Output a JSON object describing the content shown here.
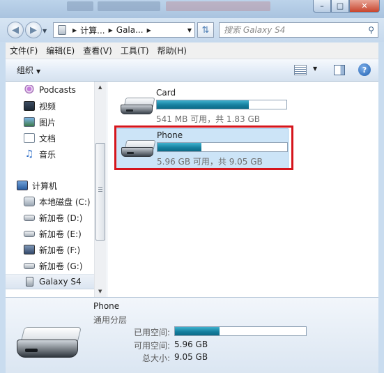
{
  "window": {
    "min_icon": "–",
    "max_icon": "□",
    "close_icon": "✕"
  },
  "address": {
    "crumbs": [
      "计算...",
      "Gala..."
    ],
    "search_placeholder": "搜索 Galaxy S4"
  },
  "menu": [
    "文件(F)",
    "编辑(E)",
    "查看(V)",
    "工具(T)",
    "帮助(H)"
  ],
  "toolbar": {
    "organize": "组织",
    "help": "?"
  },
  "nav": {
    "items": [
      {
        "label": "Podcasts",
        "icon": "podcast-icon"
      },
      {
        "label": "视频",
        "icon": "video-icon"
      },
      {
        "label": "图片",
        "icon": "pictures-icon"
      },
      {
        "label": "文档",
        "icon": "documents-icon"
      },
      {
        "label": "音乐",
        "icon": "music-icon"
      },
      {
        "label": "计算机",
        "icon": "computer-icon"
      },
      {
        "label": "本地磁盘 (C:)",
        "icon": "system-drive-icon"
      },
      {
        "label": "新加卷 (D:)",
        "icon": "drive-icon"
      },
      {
        "label": "新加卷 (E:)",
        "icon": "drive-icon"
      },
      {
        "label": "新加卷 (F:)",
        "icon": "shared-drive-icon"
      },
      {
        "label": "新加卷 (G:)",
        "icon": "drive-icon"
      },
      {
        "label": "Galaxy S4",
        "icon": "phone-icon"
      }
    ]
  },
  "drives": [
    {
      "name": "Card",
      "info": "541 MB 可用，共 1.83 GB",
      "used_fraction": 0.71
    },
    {
      "name": "Phone",
      "info": "5.96 GB 可用，共 9.05 GB",
      "used_fraction": 0.34
    }
  ],
  "details": {
    "name": "Phone",
    "type": "通用分层",
    "used_label": "已用空间:",
    "used_fraction": 0.34,
    "free_label": "可用空间:",
    "free_value": "5.96 GB",
    "total_label": "总大小:",
    "total_value": "9.05 GB"
  }
}
